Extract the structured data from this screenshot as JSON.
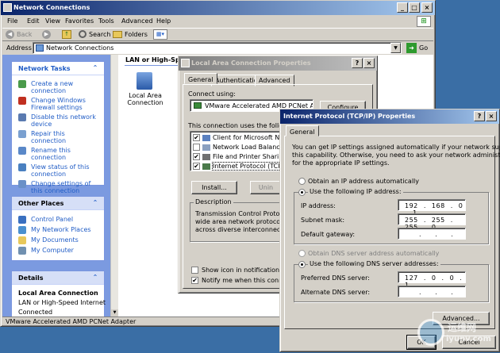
{
  "explorer": {
    "title": "Network Connections",
    "menu": [
      "File",
      "Edit",
      "View",
      "Favorites",
      "Tools",
      "Advanced",
      "Help"
    ],
    "toolbar": {
      "back": "Back",
      "search": "Search",
      "folders": "Folders"
    },
    "address_label": "Address",
    "address_value": "Network Connections",
    "go_label": "Go",
    "network_tasks": {
      "title": "Network Tasks",
      "items": [
        "Create a new connection",
        "Change Windows Firewall settings",
        "Disable this network device",
        "Repair this connection",
        "Rename this connection",
        "View status of this connection",
        "Change settings of this connection"
      ]
    },
    "other_places": {
      "title": "Other Places",
      "items": [
        "Control Panel",
        "My Network Places",
        "My Documents",
        "My Computer"
      ]
    },
    "details": {
      "title": "Details",
      "name": "Local Area Connection",
      "type": "LAN or High-Speed Internet",
      "status": "Connected"
    },
    "group_header": "LAN or High-Spee",
    "icon_label": "Local Area Connection",
    "statusbar": "VMware Accelerated AMD PCNet Adapter"
  },
  "lac_dialog": {
    "title": "Local Area Connection Properties",
    "tabs": [
      "General",
      "Authentication",
      "Advanced"
    ],
    "connect_using_label": "Connect using:",
    "adapter": "VMware Accelerated AMD PCNet Ad",
    "configure_label": "Configure",
    "items_label": "This connection uses the followin",
    "items": [
      {
        "label": "Client for Microsoft Netwo",
        "checked": "✔"
      },
      {
        "label": "Network Load Balancing",
        "checked": ""
      },
      {
        "label": "File and Printer Sharing fo",
        "checked": "✔"
      },
      {
        "label": "Internet Protocol (TCP/IP",
        "checked": "✔"
      }
    ],
    "install_label": "Install...",
    "uninstall_label": "Unin",
    "description_title": "Description",
    "description_lines": [
      "Transmission Control Protocol/Ir",
      "wide area network protocol that",
      "across diverse interconnected r"
    ],
    "show_icon_label": "Show icon in notification area v",
    "notify_label": "Notify me when this connection"
  },
  "tcpip_dialog": {
    "title": "Internet Protocol (TCP/IP) Properties",
    "tab": "General",
    "intro_lines": [
      "You can get IP settings assigned automatically if your network supports",
      "this capability. Otherwise, you need to ask your network administrator",
      "for the appropriate IP settings."
    ],
    "obtain_ip_auto": "Obtain an IP address automatically",
    "use_following_ip": "Use the following IP address:",
    "ip_address_label": "IP address:",
    "ip_address_value": "192 . 168 . 0 . 1",
    "subnet_label": "Subnet mask:",
    "subnet_value": "255 . 255 . 255 . 0",
    "gateway_label": "Default gateway:",
    "gateway_value": ". . .",
    "obtain_dns_auto": "Obtain DNS server address automatically",
    "use_following_dns": "Use the following DNS server addresses:",
    "preferred_dns_label": "Preferred DNS server:",
    "preferred_dns_value": "127 . 0 . 0 . 1",
    "alternate_dns_label": "Alternate DNS server:",
    "alternate_dns_value": ". . .",
    "advanced_label": "Advanced...",
    "ok_label": "OK",
    "cancel_label": "Cancel"
  },
  "watermark": {
    "text1": "运维网",
    "text2": "iyunv.com"
  }
}
